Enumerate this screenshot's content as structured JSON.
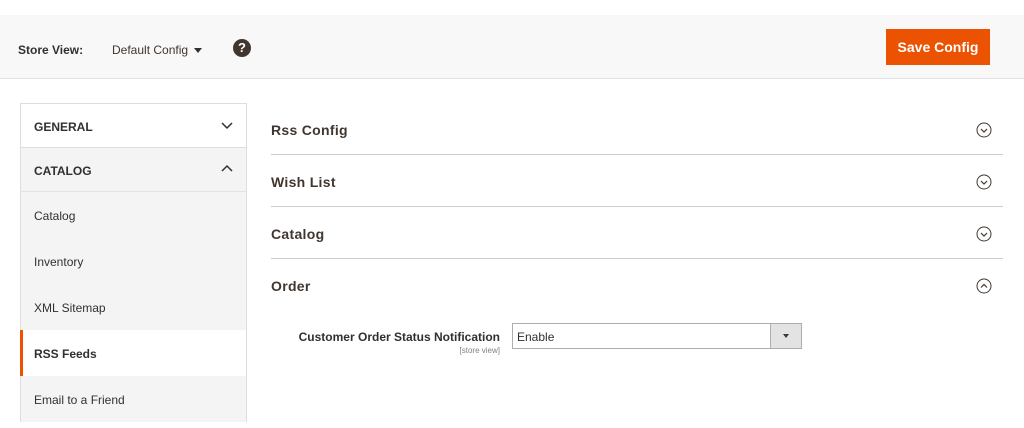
{
  "header": {
    "store_view_label": "Store View:",
    "store_view_value": "Default Config",
    "help_icon": "question-circle-icon",
    "save_label": "Save Config"
  },
  "colors": {
    "accent": "#eb5202",
    "help": "#41362f"
  },
  "sidebar": {
    "groups": [
      {
        "label": "GENERAL",
        "expanded": false
      },
      {
        "label": "CATALOG",
        "expanded": true
      }
    ],
    "items": [
      {
        "label": "Catalog",
        "active": false
      },
      {
        "label": "Inventory",
        "active": false
      },
      {
        "label": "XML Sitemap",
        "active": false
      },
      {
        "label": "RSS Feeds",
        "active": true
      },
      {
        "label": "Email to a Friend",
        "active": false
      }
    ]
  },
  "main": {
    "sections": [
      {
        "title": "Rss Config",
        "expanded": false
      },
      {
        "title": "Wish List",
        "expanded": false
      },
      {
        "title": "Catalog",
        "expanded": false
      },
      {
        "title": "Order",
        "expanded": true
      }
    ],
    "order_field": {
      "label": "Customer Order Status Notification",
      "scope": "[store view]",
      "value": "Enable"
    }
  }
}
